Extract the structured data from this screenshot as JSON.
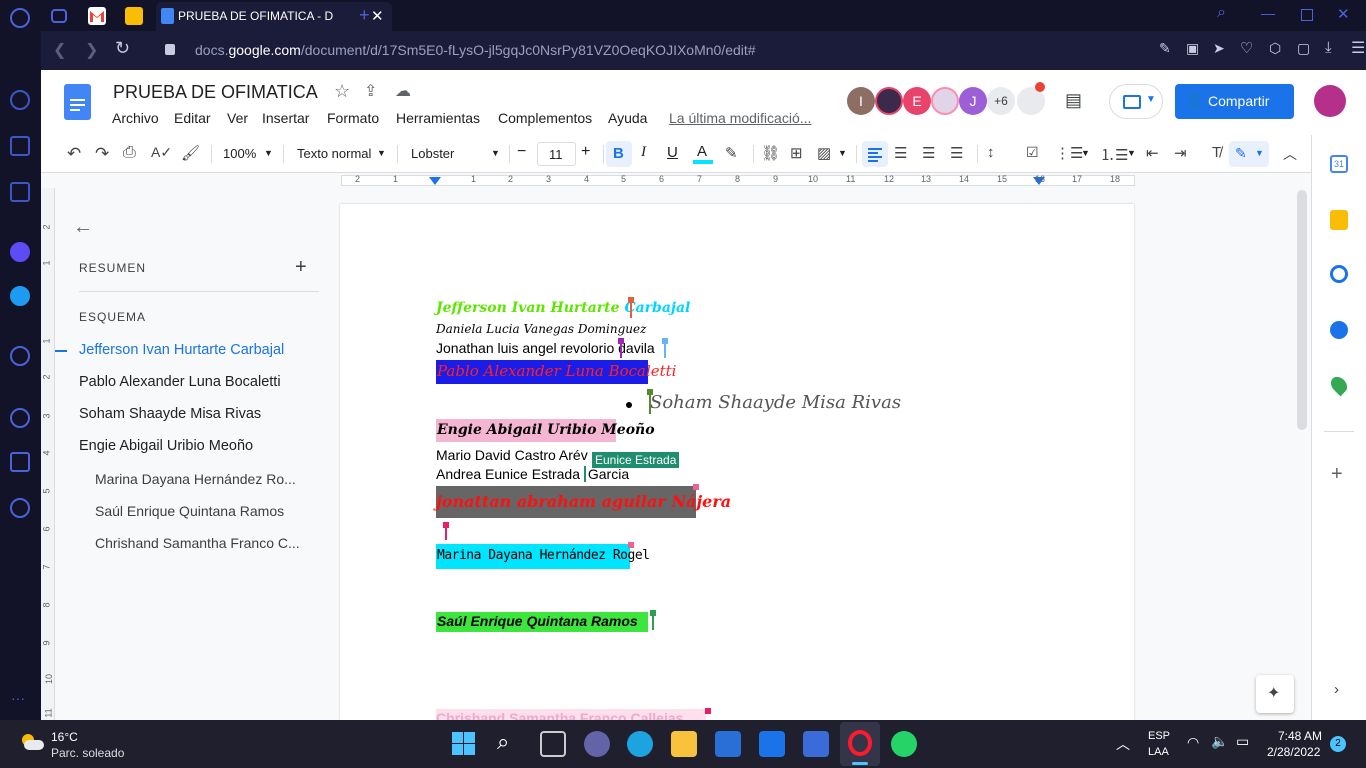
{
  "browser": {
    "tab_title": "PRUEBA DE OFIMATICA - D",
    "url_prefix": "docs.",
    "url_domain": "google.com",
    "url_path": "/document/d/17Sm5E0-fLysO-jl5gqJc0NsrPy81VZ0OeqKOJIXoMn0/edit#"
  },
  "docs": {
    "title": "PRUEBA DE OFIMATICA",
    "menu": [
      "Archivo",
      "Editar",
      "Ver",
      "Insertar",
      "Formato",
      "Herramientas",
      "Complementos",
      "Ayuda"
    ],
    "last_edit": "La última modificació...",
    "share_label": "Compartir",
    "avatars": [
      {
        "letter": "I",
        "color": "#8d6e63"
      },
      {
        "letter": "",
        "color": "#3c2a4d"
      },
      {
        "letter": "E",
        "color": "#e8436b"
      },
      {
        "letter": "",
        "color": "#e0d4e8"
      },
      {
        "letter": "J",
        "color": "#9c5fd6"
      }
    ],
    "more_collaborators": "+6"
  },
  "toolbar": {
    "zoom": "100%",
    "style": "Texto normal",
    "font": "Lobster",
    "font_size": "11"
  },
  "ruler": {
    "numbers": [
      "2",
      "1",
      "",
      "1",
      "2",
      "3",
      "4",
      "5",
      "6",
      "7",
      "8",
      "9",
      "10",
      "11",
      "12",
      "13",
      "14",
      "15",
      "16",
      "17",
      "18"
    ]
  },
  "vertical_ruler": [
    "2",
    "1",
    "",
    "1",
    "2",
    "3",
    "4",
    "5",
    "6",
    "7",
    "8",
    "9",
    "10",
    "11"
  ],
  "outline": {
    "summary_label": "RESUMEN",
    "outline_label": "ESQUEMA",
    "items": [
      {
        "label": "Jefferson Ivan Hurtarte Carbajal",
        "level": 1,
        "active": true
      },
      {
        "label": "Pablo Alexander Luna Bocaletti",
        "level": 1,
        "active": false
      },
      {
        "label": "Soham Shaayde Misa Rivas",
        "level": 1,
        "active": false
      },
      {
        "label": "Engie Abigail Uribio Meoño",
        "level": 1,
        "active": false
      },
      {
        "label": "Marina Dayana Hernández Ro...",
        "level": 2,
        "active": false
      },
      {
        "label": "Saúl Enrique Quintana Ramos",
        "level": 2,
        "active": false
      },
      {
        "label": "Chrishand Samantha Franco C...",
        "level": 2,
        "active": false
      }
    ]
  },
  "document": {
    "line1_a": "Jefferson ",
    "line1_b": "Ivan ",
    "line1_c": "Hurtarte ",
    "line1_d": "Carbajal",
    "line2": "Daniela Lucia Vanegas Dominguez",
    "line3": "Jonathan luis angel revolorio davila",
    "line4": "Pablo Alexander Luna Bocaletti",
    "line5": "Soham Shaayde Misa Rivas",
    "line6": "Engie Abigail Uribio Meoño",
    "line7": "Mario David Castro Arév",
    "collab_tag": "Eunice Estrada",
    "line8_a": " Andrea Eunice Estrada ",
    "line8_b": "Garcia",
    "line9": "jonattan abraham aguilar Nájera",
    "line10": "Marina Dayana Hernández Rogel",
    "line11": "Saúl Enrique Quintana Ramos",
    "line12": "Chrishand Samantha Franco Callejas"
  },
  "taskbar": {
    "weather_temp": "16°C",
    "weather_desc": "Parc. soleado",
    "lang_top": "ESP",
    "lang_bottom": "LAA",
    "time": "7:48 AM",
    "date": "2/28/2022",
    "notif_count": "2"
  }
}
